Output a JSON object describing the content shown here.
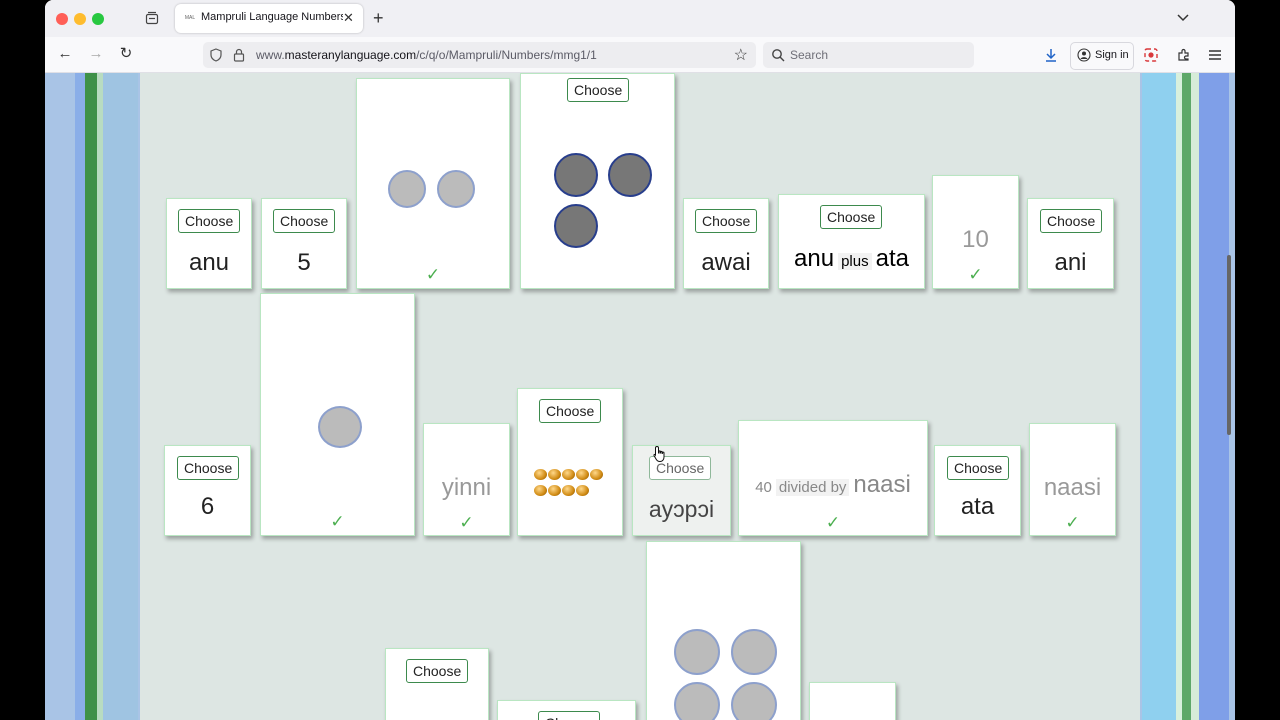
{
  "browser": {
    "tab_title": "Mampruli Language Numbers M",
    "tab_favicon_text": "MAL",
    "url_prefix": "www.",
    "url_domain": "masteranylanguage.com",
    "url_path": "/c/q/o/Mampruli/Numbers/mmg1/1",
    "search_placeholder": "Search",
    "signin_label": "Sign in"
  },
  "game": {
    "choose_label": "Choose",
    "check_mark": "✓",
    "cards_row1": {
      "anu": "anu",
      "five": "5",
      "awai": "awai",
      "expr_a": "anu",
      "expr_op": "plus",
      "expr_b": "ata",
      "ten": "10",
      "ani": "ani"
    },
    "cards_row2": {
      "six": "6",
      "yinni": "yinni",
      "ayopoi": "ayɔpɔi",
      "div_a": "40",
      "div_op": "divided by",
      "div_b": "naasi",
      "ata": "ata",
      "naasi": "naasi"
    },
    "dot_counts": {
      "two_dots_card": 2,
      "three_dots_card": 3,
      "one_dot_card": 1,
      "four_dots_card": 4,
      "beads_card": 9
    }
  },
  "colors": {
    "card_border": "#b9e6c2",
    "check": "#4caf50",
    "button_border": "#3d8a4d",
    "dark_dot_border": "#283e8c"
  }
}
